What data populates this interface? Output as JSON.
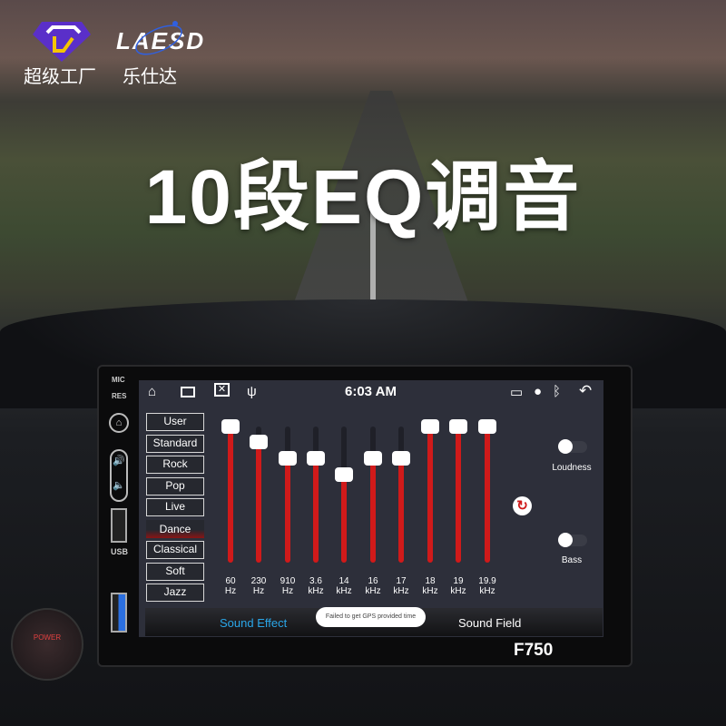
{
  "branding": {
    "logo_left_caption": "超级工厂",
    "logo_right_text": "LAESD",
    "logo_right_caption": "乐仕达",
    "headline": "10段EQ调音",
    "model": "F750"
  },
  "device_side": {
    "mic": "MIC",
    "res": "RES",
    "usb": "USB"
  },
  "status_bar": {
    "time": "6:03 AM",
    "icons": [
      "home-icon",
      "recent-apps-icon",
      "close-window-icon",
      "usb-icon",
      "cast-icon",
      "location-icon",
      "bluetooth-icon",
      "back-icon"
    ]
  },
  "presets": [
    {
      "label": "User"
    },
    {
      "label": "Standard"
    },
    {
      "label": "Rock"
    },
    {
      "label": "Pop"
    },
    {
      "label": "Live"
    },
    {
      "label": "Dance",
      "active": true
    },
    {
      "label": "Classical"
    },
    {
      "label": "Soft"
    },
    {
      "label": "Jazz"
    }
  ],
  "eq_bands": [
    {
      "freq": "60",
      "unit": "Hz",
      "level": 1.0
    },
    {
      "freq": "230",
      "unit": "Hz",
      "level": 0.89
    },
    {
      "freq": "910",
      "unit": "Hz",
      "level": 0.77
    },
    {
      "freq": "3.6",
      "unit": "kHz",
      "level": 0.77
    },
    {
      "freq": "14",
      "unit": "kHz",
      "level": 0.65
    },
    {
      "freq": "16",
      "unit": "kHz",
      "level": 0.77
    },
    {
      "freq": "17",
      "unit": "kHz",
      "level": 0.77
    },
    {
      "freq": "18",
      "unit": "kHz",
      "level": 1.0
    },
    {
      "freq": "19",
      "unit": "kHz",
      "level": 1.0
    },
    {
      "freq": "19.9",
      "unit": "kHz",
      "level": 1.0
    }
  ],
  "toggles": {
    "loudness": {
      "label": "Loudness",
      "on": false
    },
    "bass": {
      "label": "Bass",
      "on": false
    }
  },
  "tabs": {
    "sound_effect": "Sound Effect",
    "sound_field": "Sound Field",
    "active": "sound_effect"
  },
  "toast": "Failed to get GPS provided time",
  "colors": {
    "accent": "#d01a1a",
    "active_tab": "#2aa6e8",
    "screen_bg": "#2d2f3a"
  }
}
